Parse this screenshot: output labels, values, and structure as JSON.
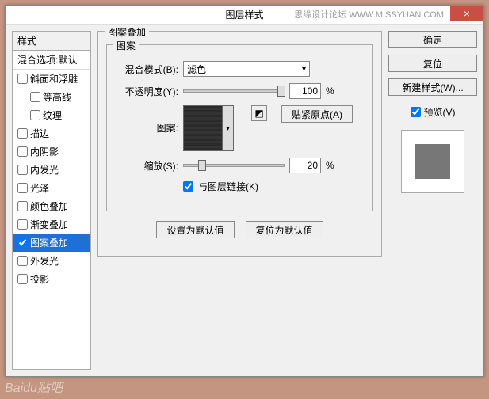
{
  "titlebar": {
    "title": "图层样式",
    "branding": "思缘设计论坛  WWW.MISSYUAN.COM",
    "close": "×"
  },
  "left": {
    "header": "样式",
    "sub": "混合选项:默认",
    "items": [
      {
        "label": "斜面和浮雕",
        "checked": false,
        "indent": false
      },
      {
        "label": "等高线",
        "checked": false,
        "indent": true
      },
      {
        "label": "纹理",
        "checked": false,
        "indent": true
      },
      {
        "label": "描边",
        "checked": false,
        "indent": false
      },
      {
        "label": "内阴影",
        "checked": false,
        "indent": false
      },
      {
        "label": "内发光",
        "checked": false,
        "indent": false
      },
      {
        "label": "光泽",
        "checked": false,
        "indent": false
      },
      {
        "label": "颜色叠加",
        "checked": false,
        "indent": false
      },
      {
        "label": "渐变叠加",
        "checked": false,
        "indent": false
      },
      {
        "label": "图案叠加",
        "checked": true,
        "indent": false,
        "selected": true
      },
      {
        "label": "外发光",
        "checked": false,
        "indent": false
      },
      {
        "label": "投影",
        "checked": false,
        "indent": false
      }
    ]
  },
  "mid": {
    "outerLegend": "图案叠加",
    "innerLegend": "图案",
    "blendLabel": "混合模式(B):",
    "blendValue": "滤色",
    "opacityLabel": "不透明度(Y):",
    "opacityValue": "100",
    "percent": "%",
    "patternLabel": "图案:",
    "snapBtn": "贴紧原点(A)",
    "scaleLabel": "缩放(S):",
    "scaleValue": "20",
    "linkLabel": "与图层链接(K)",
    "setDefault": "设置为默认值",
    "resetDefault": "复位为默认值"
  },
  "right": {
    "ok": "确定",
    "cancel": "复位",
    "newStyle": "新建样式(W)...",
    "previewLabel": "预览(V)"
  },
  "footer": "Baidu贴吧"
}
